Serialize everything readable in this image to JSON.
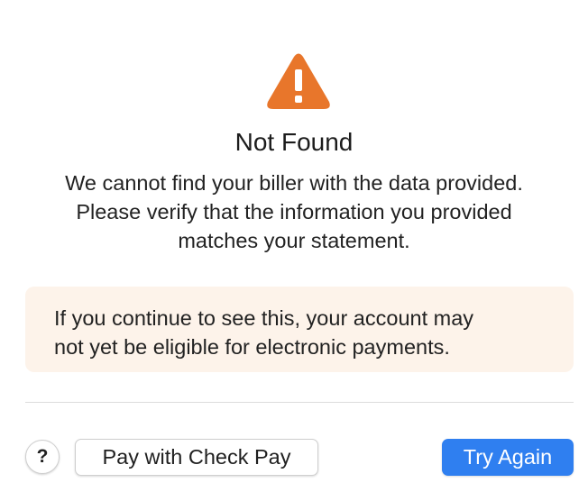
{
  "dialog": {
    "icon": "warning-triangle-icon",
    "icon_color": "#e8762b",
    "title": "Not Found",
    "message_line_1": "We cannot find your biller with the data provided.",
    "message_line_2": "Please verify that the information you provided",
    "message_line_3": "matches your statement.",
    "notice_line_1": "If you continue to see this, your account may",
    "notice_line_2": "not yet be eligible for electronic payments.",
    "notice_background": "#fdf3ea"
  },
  "footer": {
    "help_label": "?",
    "check_pay_label": "Pay with Check Pay",
    "try_again_label": "Try Again",
    "primary_color": "#2f7ff0"
  }
}
